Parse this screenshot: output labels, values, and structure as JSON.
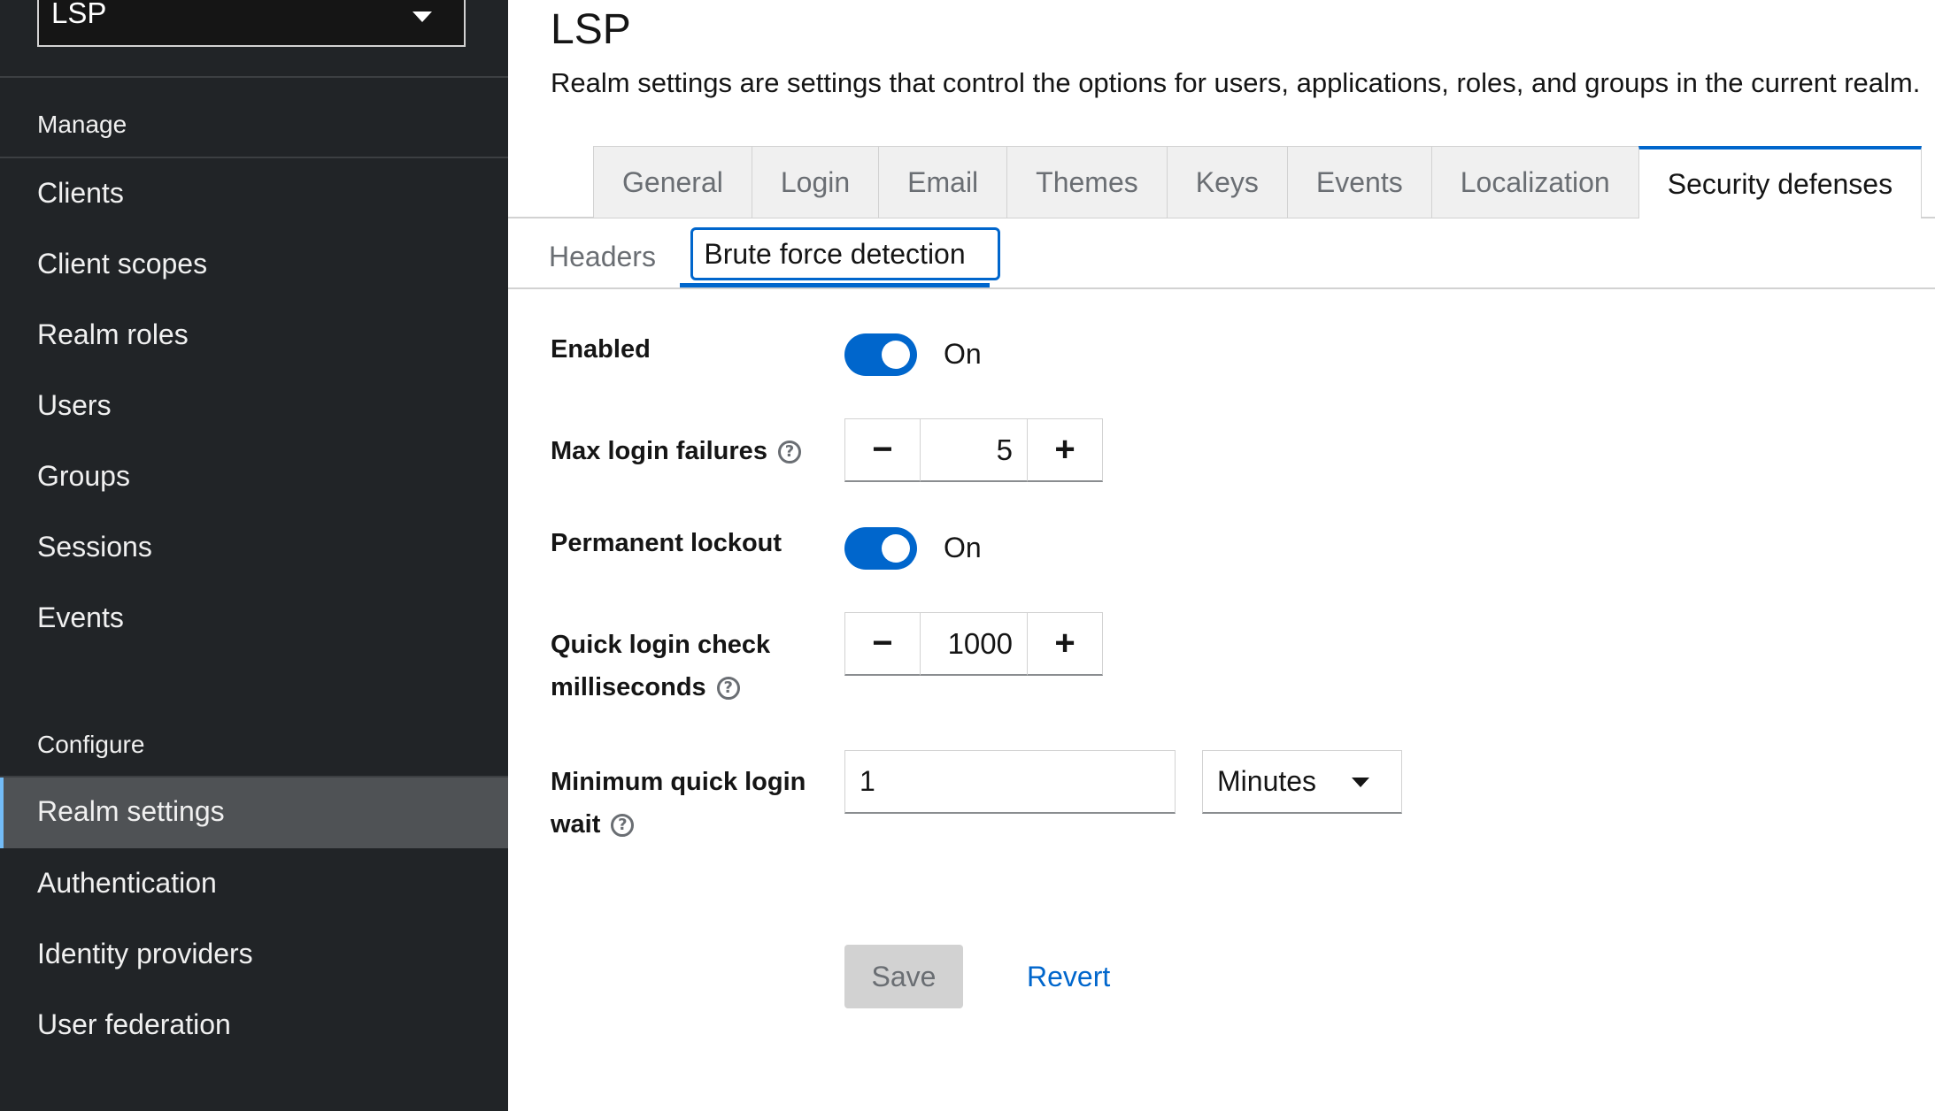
{
  "sidebar": {
    "realm_selector": "LSP",
    "manage_title": "Manage",
    "manage_items": [
      {
        "label": "Clients"
      },
      {
        "label": "Client scopes"
      },
      {
        "label": "Realm roles"
      },
      {
        "label": "Users"
      },
      {
        "label": "Groups"
      },
      {
        "label": "Sessions"
      },
      {
        "label": "Events"
      }
    ],
    "configure_title": "Configure",
    "configure_items": [
      {
        "label": "Realm settings",
        "active": true
      },
      {
        "label": "Authentication"
      },
      {
        "label": "Identity providers"
      },
      {
        "label": "User federation"
      }
    ]
  },
  "header": {
    "title": "LSP",
    "description": "Realm settings are settings that control the options for users, applications, roles, and groups in the current realm."
  },
  "tabs": [
    {
      "label": "General"
    },
    {
      "label": "Login"
    },
    {
      "label": "Email"
    },
    {
      "label": "Themes"
    },
    {
      "label": "Keys"
    },
    {
      "label": "Events"
    },
    {
      "label": "Localization"
    },
    {
      "label": "Security defenses",
      "active": true
    }
  ],
  "subtabs": [
    {
      "label": "Headers"
    },
    {
      "label": "Brute force detection",
      "active": true
    }
  ],
  "form": {
    "enabled": {
      "label": "Enabled",
      "state": "On"
    },
    "max_login_failures": {
      "label": "Max login failures",
      "value": "5"
    },
    "permanent_lockout": {
      "label": "Permanent lockout",
      "state": "On"
    },
    "quick_login_check": {
      "label_line1": "Quick login check",
      "label_line2": "milliseconds",
      "value": "1000"
    },
    "min_quick_login_wait": {
      "label_line1": "Minimum quick login",
      "label_line2": "wait",
      "value": "1",
      "unit": "Minutes"
    }
  },
  "actions": {
    "save": "Save",
    "revert": "Revert"
  },
  "colors": {
    "sidebar_bg": "#212427",
    "accent": "#0066cc",
    "active_nav_bg": "#4f5255"
  }
}
